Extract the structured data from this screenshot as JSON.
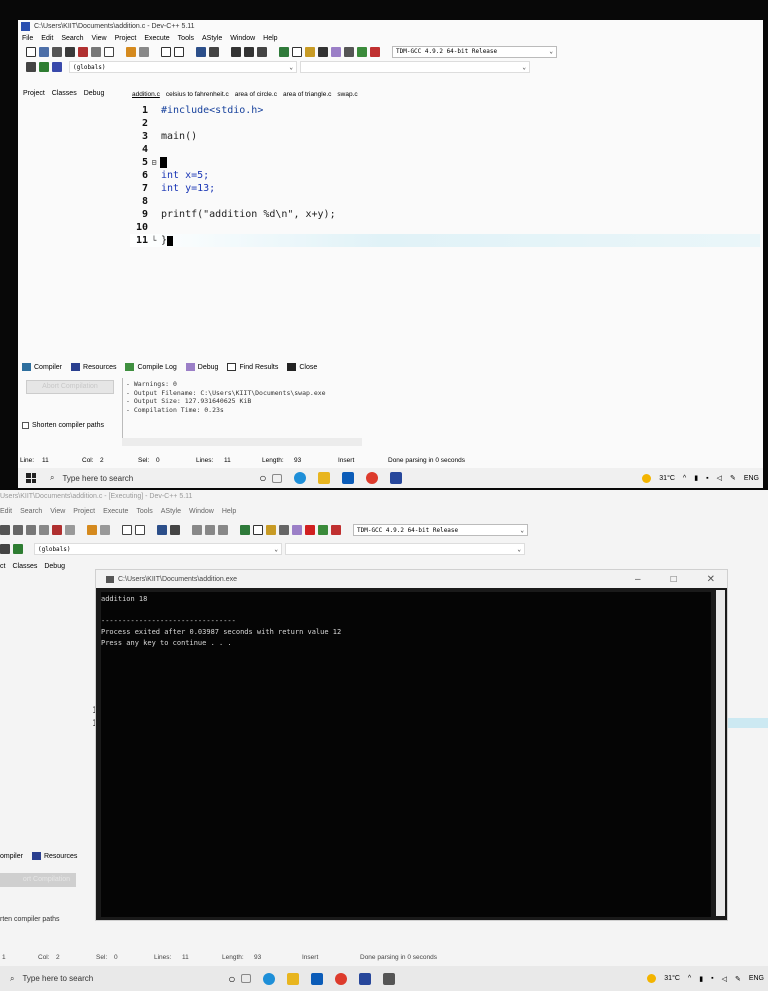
{
  "top": {
    "title": "C:\\Users\\KIIT\\Documents\\addition.c - Dev-C++ 5.11",
    "menu": [
      "File",
      "Edit",
      "Search",
      "View",
      "Project",
      "Execute",
      "Tools",
      "AStyle",
      "Window",
      "Help"
    ],
    "compiler_select": "TDM-GCC 4.9.2 64-bit Release",
    "scope_select": "(globals)",
    "left_tabs": [
      "Project",
      "Classes",
      "Debug"
    ],
    "file_tabs": [
      "addition.c",
      "celsius to fahrenheit.c",
      "area of circle.c",
      "area of triangle.c",
      "swap.c"
    ],
    "code_lines": [
      {
        "n": "1",
        "text": "#include<stdio.h>"
      },
      {
        "n": "2",
        "text": ""
      },
      {
        "n": "3",
        "text": "main()"
      },
      {
        "n": "4",
        "text": ""
      },
      {
        "n": "5",
        "text": "{"
      },
      {
        "n": "6",
        "text": "int x=5;"
      },
      {
        "n": "7",
        "text": "int y=13;"
      },
      {
        "n": "8",
        "text": ""
      },
      {
        "n": "9",
        "text": "printf(\"addition %d\\n\", x+y);"
      },
      {
        "n": "10",
        "text": ""
      },
      {
        "n": "11",
        "text": "}"
      }
    ],
    "bottom_tabs": [
      "Compiler",
      "Resources",
      "Compile Log",
      "Debug",
      "Find Results",
      "Close"
    ],
    "abort_button": "Abort Compilation",
    "shorten_label": "Shorten compiler paths",
    "log": "- Warnings: 0\n- Output Filename: C:\\Users\\KIIT\\Documents\\swap.exe\n- Output Size: 127.931640625 KiB\n- Compilation Time: 0.23s",
    "status": {
      "line": "Line:",
      "line_val": "11",
      "col": "Col:",
      "col_val": "2",
      "sel": "Sel:",
      "sel_val": "0",
      "lines": "Lines:",
      "lines_val": "11",
      "length": "Length:",
      "length_val": "93",
      "mode": "Insert",
      "parsing": "Done parsing in 0 seconds"
    },
    "taskbar": {
      "search": "Type here to search",
      "temp": "31°C",
      "lang": "ENG"
    }
  },
  "bottom": {
    "title": "Users\\KIIT\\Documents\\addition.c - [Executing] - Dev-C++ 5.11",
    "menu": [
      "Edit",
      "Search",
      "View",
      "Project",
      "Execute",
      "Tools",
      "AStyle",
      "Window",
      "Help"
    ],
    "compiler_select": "TDM-GCC 4.9.2 64-bit Release",
    "scope_select": "(globals)",
    "left_tabs": [
      "ct",
      "Classes",
      "Debug"
    ],
    "console_title": "C:\\Users\\KIIT\\Documents\\addition.exe",
    "console_output": "addition 18\n\n--------------------------------\nProcess exited after 0.03987 seconds with return value 12\nPress any key to continue . . .",
    "compiler_tab": "ompiler",
    "resources_tab": "Resources",
    "abort_button": "ort Compilation",
    "shorten_label": "rten compiler paths",
    "status": {
      "line_val": "1",
      "col": "Col:",
      "col_val": "2",
      "sel": "Sel:",
      "sel_val": "0",
      "lines": "Lines:",
      "lines_val": "11",
      "length": "Length:",
      "length_val": "93",
      "mode": "Insert",
      "parsing": "Done parsing in 0 seconds"
    },
    "taskbar": {
      "search": "Type here to search",
      "temp": "31°C",
      "lang": "ENG"
    }
  }
}
